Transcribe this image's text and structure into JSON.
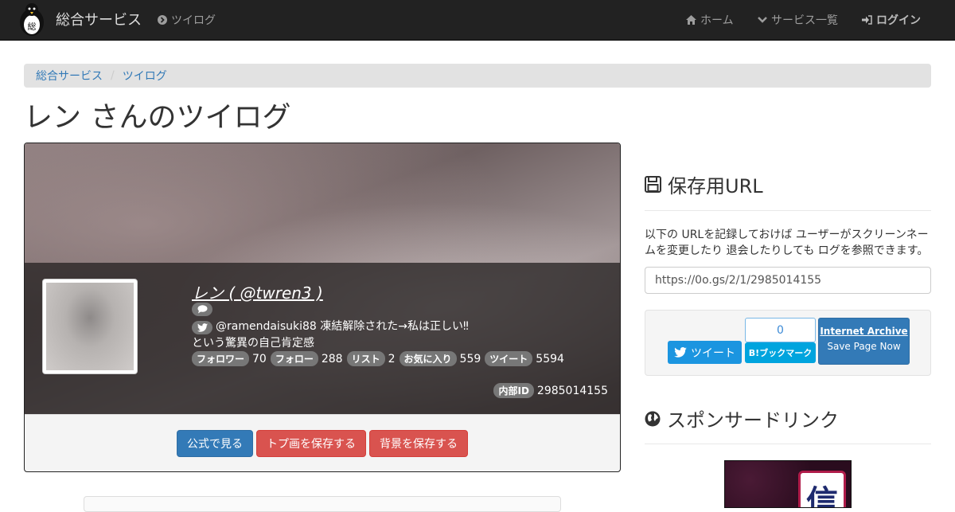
{
  "navbar": {
    "brand": "総合サービス",
    "twilog_link": "ツイログ",
    "home": "ホーム",
    "services": "サービス一覧",
    "login": "ログイン"
  },
  "breadcrumb": {
    "item1": "総合サービス",
    "sep": "/",
    "item2": "ツイログ"
  },
  "page_title": "レン さんのツイログ",
  "profile": {
    "name": "レン ( @twren3 )",
    "bio_line1": "@ramendaisuki88 凍結解除された→私は正しい‼",
    "bio_line2": "という驚異の自己肯定感",
    "stats": [
      {
        "label": "フォロワー",
        "value": "70"
      },
      {
        "label": "フォロー",
        "value": "288"
      },
      {
        "label": "リスト",
        "value": "2"
      },
      {
        "label": "お気に入り",
        "value": "559"
      },
      {
        "label": "ツイート",
        "value": "5594"
      }
    ],
    "internal_id_label": "内部ID",
    "internal_id": "2985014155"
  },
  "actions": {
    "official": "公式で見る",
    "save_icon": "トプ画を保存する",
    "save_bg": "背景を保存する"
  },
  "sidebar": {
    "save_url_title": "保存用URL",
    "description": "以下の URLを記録しておけば ユーザーがスクリーンネームを変更したり 退会したりしても ログを参照できます。",
    "url": "https://0o.gs/2/1/2985014155",
    "tweet": "ツイート",
    "hatena_count": "0",
    "hatena_label": "B!ブックマーク",
    "ia_title": "Internet Archive",
    "ia_sub": "Save Page Now",
    "sponsor_title": "スポンサードリンク",
    "ad_glyph": "信"
  },
  "colors": {
    "navbar": "#222222",
    "primary": "#337ab7",
    "danger": "#d9534f",
    "twitter": "#1b95e0",
    "hatena": "#00a4de"
  }
}
